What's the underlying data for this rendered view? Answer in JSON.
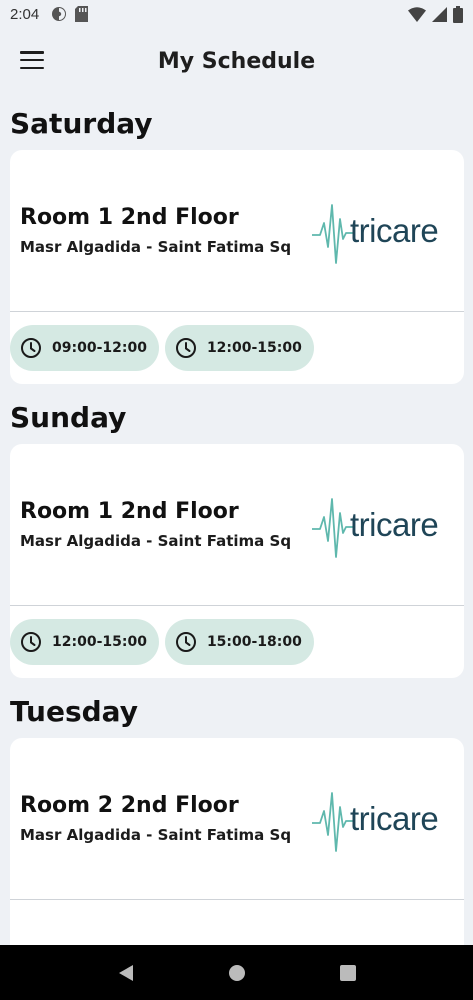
{
  "status_bar": {
    "time": "2:04",
    "left_icons": [
      "vpn-key-icon",
      "sd-card-icon"
    ],
    "right_icons": [
      "wifi-icon",
      "cell-signal-icon",
      "battery-icon"
    ]
  },
  "app_bar": {
    "title": "My Schedule",
    "menu_icon": "hamburger-menu-icon"
  },
  "schedule": [
    {
      "day": "Saturday",
      "room": "Room 1 2nd Floor",
      "location": "Masr Algadida - Saint Fatima Sq",
      "logo_text": "tricare",
      "slots": [
        "09:00-12:00",
        "12:00-15:00"
      ]
    },
    {
      "day": "Sunday",
      "room": "Room 1 2nd Floor",
      "location": "Masr Algadida - Saint Fatima Sq",
      "logo_text": "tricare",
      "slots": [
        "12:00-15:00",
        "15:00-18:00"
      ]
    },
    {
      "day": "Tuesday",
      "room": "Room 2 2nd Floor",
      "location": "Masr Algadida - Saint Fatima Sq",
      "logo_text": "tricare",
      "slots": []
    }
  ],
  "nav_bar": {
    "buttons": [
      "back-icon",
      "home-icon",
      "recents-icon"
    ]
  },
  "colors": {
    "background": "#eef1f5",
    "card": "#ffffff",
    "chip": "#d5e9e3",
    "logo_teal": "#5fb8ad",
    "logo_navy": "#1f4557"
  }
}
